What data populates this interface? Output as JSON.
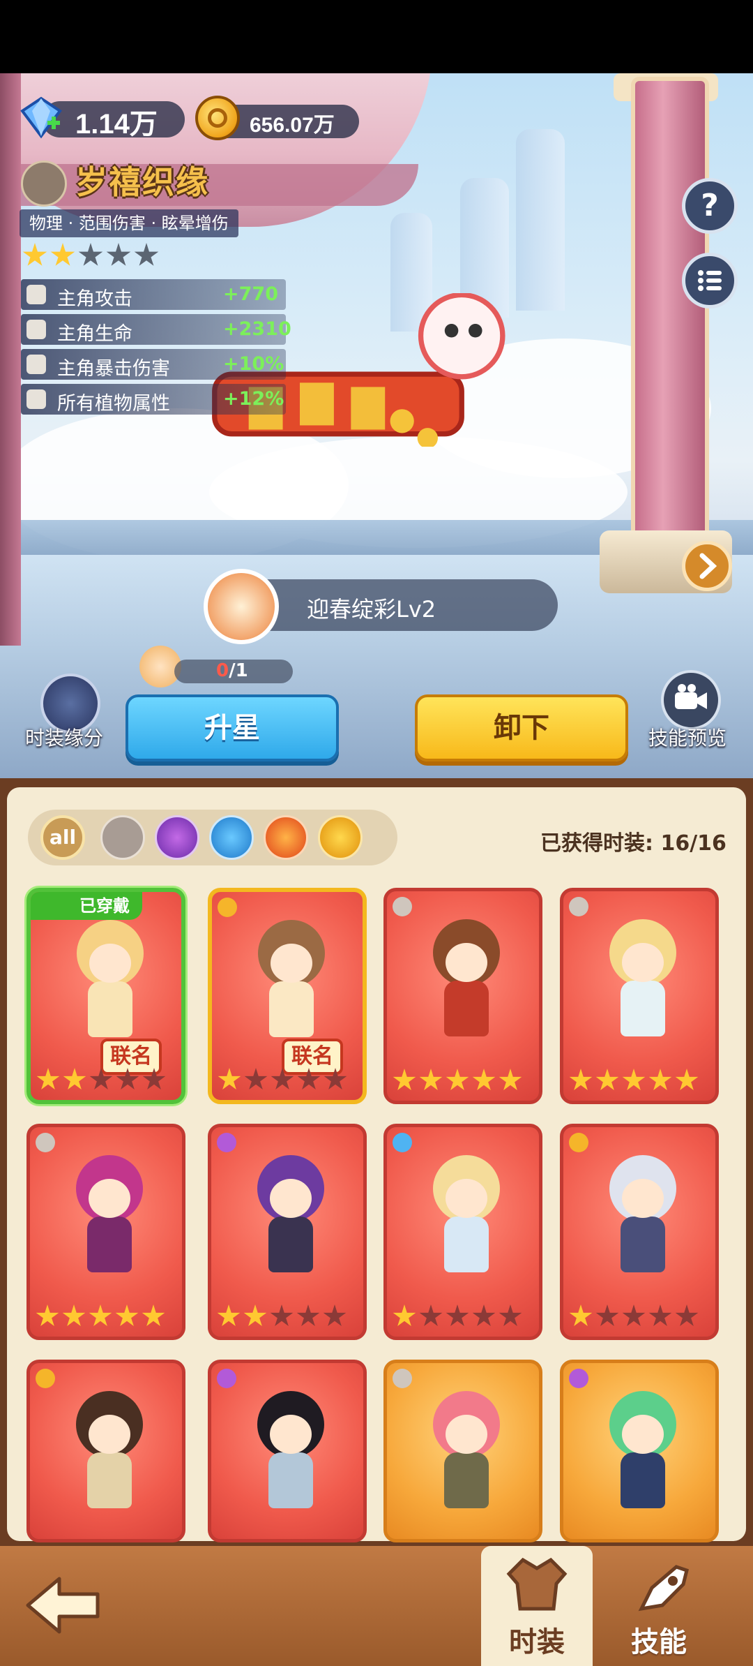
{
  "currency": {
    "gems": "1.14万",
    "coins": "656.07万"
  },
  "costume": {
    "name": "岁禧织缘",
    "tags": "物理 · 范围伤害 · 眩晕增伤",
    "stars": 2,
    "max_stars": 5,
    "stats": [
      {
        "label": "主角攻击",
        "value": "+770"
      },
      {
        "label": "主角生命",
        "value": "+2310"
      },
      {
        "label": "主角暴击伤害",
        "value": "+10%"
      },
      {
        "label": "所有植物属性",
        "value": "+12%"
      }
    ]
  },
  "skin": {
    "name": "迎春绽彩Lv2",
    "progress_current": "0",
    "progress_total": "/1"
  },
  "buttons": {
    "upgrade_star": "升星",
    "unload": "卸下",
    "fashion_fate": "时装缘分",
    "skill_preview": "技能预览",
    "help": "?"
  },
  "filters": [
    {
      "name": "all",
      "label": "all"
    },
    {
      "name": "physical"
    },
    {
      "name": "poison"
    },
    {
      "name": "water"
    },
    {
      "name": "fire"
    },
    {
      "name": "lightning"
    }
  ],
  "obtained": "已获得时装: 16/16",
  "cards": [
    {
      "elem": "physical",
      "stars": 2,
      "color": "red",
      "label": "联名",
      "worn": "已穿戴",
      "head": "#f6d184",
      "body": "#f9e4b5"
    },
    {
      "elem": "lightning",
      "stars": 1,
      "color": "red",
      "label": "联名",
      "head": "#9b6a44",
      "body": "#fbe8c4"
    },
    {
      "elem": "physical",
      "stars": 5,
      "color": "red",
      "head": "#8a4b2a",
      "body": "#c43b2a"
    },
    {
      "elem": "physical",
      "stars": 5,
      "color": "red",
      "head": "#f5d98b",
      "body": "#e6f2f5"
    },
    {
      "elem": "physical",
      "stars": 5,
      "color": "red",
      "head": "#c2368c",
      "body": "#7a2a6a"
    },
    {
      "elem": "poison",
      "stars": 2,
      "color": "red",
      "head": "#6d3ba0",
      "body": "#3a3350"
    },
    {
      "elem": "water",
      "stars": 1,
      "color": "red",
      "head": "#f5dc9a",
      "body": "#d8e8f5"
    },
    {
      "elem": "lightning",
      "stars": 1,
      "color": "red",
      "head": "#dfe3ee",
      "body": "#4a4f7a"
    },
    {
      "elem": "lightning",
      "stars": 0,
      "color": "red",
      "head": "#4a2f22",
      "body": "#e4d2a8"
    },
    {
      "elem": "poison",
      "stars": 0,
      "color": "red",
      "head": "#1f1b22",
      "body": "#b3c7d8"
    },
    {
      "elem": "physical",
      "stars": 0,
      "color": "orange",
      "head": "#f27a8a",
      "body": "#6f6a4a"
    },
    {
      "elem": "poison",
      "stars": 0,
      "color": "orange",
      "head": "#5ccf8b",
      "body": "#2f3f6a"
    }
  ],
  "nav": {
    "back": "back-arrow-icon",
    "fashion": "时装",
    "skill": "技能"
  },
  "colors": {
    "accent_blue": "#2fa9ea",
    "accent_yellow": "#f8b91a",
    "stat_green": "#7cf05a",
    "progress_red": "#ff5a4a",
    "panel_bg": "#f5ebd3",
    "nav_brown": "#9a5a2b"
  }
}
